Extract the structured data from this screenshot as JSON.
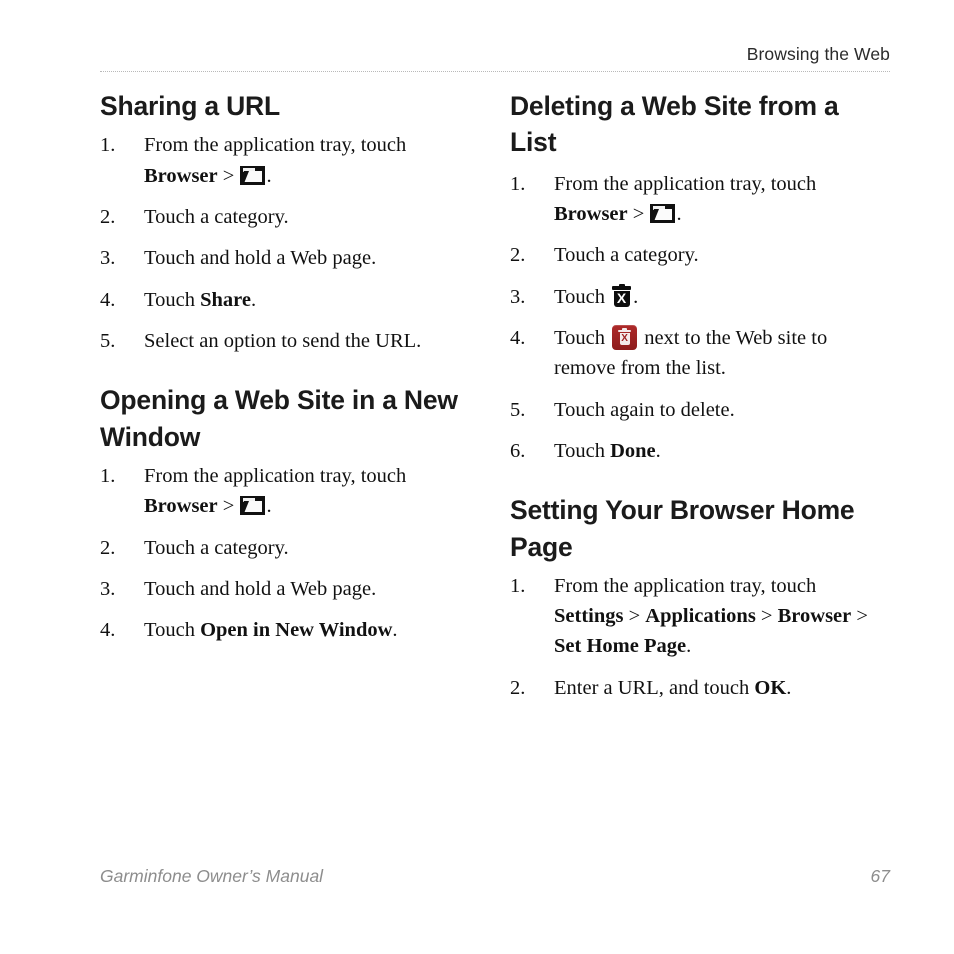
{
  "header": {
    "title": "Browsing the Web"
  },
  "footer": {
    "manual_title": "Garminfone Owner’s Manual",
    "page_number": "67"
  },
  "colors": {
    "text": "#111111",
    "heading": "#1b1b1b",
    "header_text": "#2b2b2b",
    "footer_text": "#8d8d8d",
    "rule": "#b9b9b9",
    "delete_button_red": "#9e2222",
    "icon_dark": "#0d0d0d"
  },
  "left_column": {
    "sections": [
      {
        "heading": "Sharing a URL",
        "steps": [
          {
            "num": "1.",
            "parts": [
              {
                "type": "text",
                "value": "From the application tray, touch "
              },
              {
                "type": "bold",
                "value": "Browser"
              },
              {
                "type": "text",
                "value": " > "
              },
              {
                "type": "icon",
                "value": "bookmarks-folder-icon"
              },
              {
                "type": "text",
                "value": "."
              }
            ]
          },
          {
            "num": "2.",
            "parts": [
              {
                "type": "text",
                "value": "Touch a category."
              }
            ]
          },
          {
            "num": "3.",
            "parts": [
              {
                "type": "text",
                "value": "Touch and hold a Web page."
              }
            ]
          },
          {
            "num": "4.",
            "parts": [
              {
                "type": "text",
                "value": "Touch "
              },
              {
                "type": "bold",
                "value": "Share"
              },
              {
                "type": "text",
                "value": "."
              }
            ]
          },
          {
            "num": "5.",
            "parts": [
              {
                "type": "text",
                "value": "Select an option to send the URL."
              }
            ]
          }
        ]
      },
      {
        "heading": "Opening a Web Site in a New Window",
        "steps": [
          {
            "num": "1.",
            "parts": [
              {
                "type": "text",
                "value": "From the application tray, touch "
              },
              {
                "type": "bold",
                "value": "Browser"
              },
              {
                "type": "text",
                "value": " > "
              },
              {
                "type": "icon",
                "value": "bookmarks-folder-icon"
              },
              {
                "type": "text",
                "value": "."
              }
            ]
          },
          {
            "num": "2.",
            "parts": [
              {
                "type": "text",
                "value": "Touch a category."
              }
            ]
          },
          {
            "num": "3.",
            "parts": [
              {
                "type": "text",
                "value": "Touch and hold a Web page."
              }
            ]
          },
          {
            "num": "4.",
            "parts": [
              {
                "type": "text",
                "value": "Touch "
              },
              {
                "type": "bold",
                "value": "Open in New Window"
              },
              {
                "type": "text",
                "value": "."
              }
            ]
          }
        ]
      }
    ]
  },
  "right_column": {
    "sections": [
      {
        "heading": "Deleting a Web Site from a List",
        "steps": [
          {
            "num": "1.",
            "parts": [
              {
                "type": "text",
                "value": "From the application tray, touch "
              },
              {
                "type": "bold",
                "value": "Browser"
              },
              {
                "type": "text",
                "value": " > "
              },
              {
                "type": "icon",
                "value": "bookmarks-folder-icon"
              },
              {
                "type": "text",
                "value": "."
              }
            ]
          },
          {
            "num": "2.",
            "parts": [
              {
                "type": "text",
                "value": "Touch a category."
              }
            ]
          },
          {
            "num": "3.",
            "parts": [
              {
                "type": "text",
                "value": "Touch "
              },
              {
                "type": "icon",
                "value": "trash-x-icon"
              },
              {
                "type": "text",
                "value": "."
              }
            ]
          },
          {
            "num": "4.",
            "parts": [
              {
                "type": "text",
                "value": "Touch "
              },
              {
                "type": "icon",
                "value": "delete-red-button-icon"
              },
              {
                "type": "text",
                "value": " next to the Web site to remove from the list."
              }
            ]
          },
          {
            "num": "5.",
            "parts": [
              {
                "type": "text",
                "value": "Touch again to delete."
              }
            ]
          },
          {
            "num": "6.",
            "parts": [
              {
                "type": "text",
                "value": "Touch "
              },
              {
                "type": "bold",
                "value": "Done"
              },
              {
                "type": "text",
                "value": "."
              }
            ]
          }
        ]
      },
      {
        "heading": "Setting Your Browser Home Page",
        "steps": [
          {
            "num": "1.",
            "parts": [
              {
                "type": "text",
                "value": "From the application tray, touch "
              },
              {
                "type": "bold",
                "value": "Settings"
              },
              {
                "type": "text",
                "value": " > "
              },
              {
                "type": "bold",
                "value": "Applications"
              },
              {
                "type": "text",
                "value": " > "
              },
              {
                "type": "bold",
                "value": "Browser"
              },
              {
                "type": "text",
                "value": " > "
              },
              {
                "type": "bold",
                "value": "Set Home Page"
              },
              {
                "type": "text",
                "value": "."
              }
            ]
          },
          {
            "num": "2.",
            "parts": [
              {
                "type": "text",
                "value": "Enter a URL, and touch "
              },
              {
                "type": "bold",
                "value": "OK"
              },
              {
                "type": "text",
                "value": "."
              }
            ]
          }
        ]
      }
    ]
  }
}
